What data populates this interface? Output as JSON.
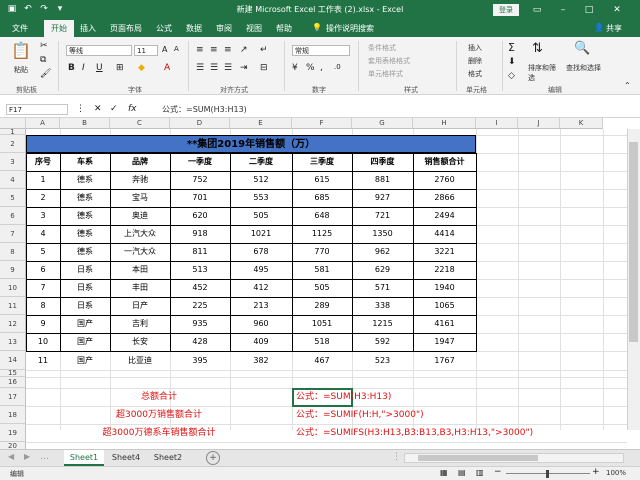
{
  "window": {
    "title": "新建 Microsoft Excel 工作表 (2).xlsx  -  Excel",
    "login": "登录"
  },
  "tabs": [
    {
      "label": "文件"
    },
    {
      "label": "开始"
    },
    {
      "label": "插入"
    },
    {
      "label": "页面布局"
    },
    {
      "label": "公式"
    },
    {
      "label": "数据"
    },
    {
      "label": "审阅"
    },
    {
      "label": "视图"
    },
    {
      "label": "帮助"
    },
    {
      "label": "操作说明搜索"
    }
  ],
  "share_label": "共享",
  "ribbon": {
    "paste": "粘贴",
    "font_name": "等线",
    "font_size": "11",
    "conditional_format": "条件格式",
    "table_format": "套用表格格式",
    "cell_style": "单元格样式",
    "number_format": "常规",
    "insert": "插入",
    "delete": "删除",
    "format": "格式",
    "sort_filter": "排序和筛选",
    "find_select": "查找和选择",
    "groups": [
      "剪贴板",
      "字体",
      "对齐方式",
      "数字",
      "样式",
      "单元格",
      "编辑"
    ]
  },
  "formula_bar": {
    "name_box": "F17",
    "content": "公式：=SUM(H3:H13)"
  },
  "columns": [
    "A",
    "B",
    "C",
    "D",
    "E",
    "F",
    "G",
    "H",
    "I",
    "J",
    "K"
  ],
  "rows": [
    "1",
    "2",
    "3",
    "4",
    "5",
    "6",
    "7",
    "8",
    "9",
    "10",
    "11",
    "12",
    "13",
    "14",
    "15",
    "16",
    "17",
    "18",
    "19",
    "20"
  ],
  "table": {
    "title": "**集团2019年销售额（万）",
    "headers": [
      "序号",
      "车系",
      "品牌",
      "一季度",
      "二季度",
      "三季度",
      "四季度",
      "销售额合计"
    ],
    "rows": [
      [
        "1",
        "德系",
        "奔驰",
        "752",
        "512",
        "615",
        "881",
        "2760"
      ],
      [
        "2",
        "德系",
        "宝马",
        "701",
        "553",
        "685",
        "927",
        "2866"
      ],
      [
        "3",
        "德系",
        "奥迪",
        "620",
        "505",
        "648",
        "721",
        "2494"
      ],
      [
        "4",
        "德系",
        "上汽大众",
        "918",
        "1021",
        "1125",
        "1350",
        "4414"
      ],
      [
        "5",
        "德系",
        "一汽大众",
        "811",
        "678",
        "770",
        "962",
        "3221"
      ],
      [
        "6",
        "日系",
        "本田",
        "513",
        "495",
        "581",
        "629",
        "2218"
      ],
      [
        "7",
        "日系",
        "丰田",
        "452",
        "412",
        "505",
        "571",
        "1940"
      ],
      [
        "8",
        "日系",
        "日产",
        "225",
        "213",
        "289",
        "338",
        "1065"
      ],
      [
        "9",
        "国产",
        "吉利",
        "935",
        "960",
        "1051",
        "1215",
        "4161"
      ],
      [
        "10",
        "国产",
        "长安",
        "428",
        "409",
        "518",
        "592",
        "1947"
      ],
      [
        "11",
        "国产",
        "比亚迪",
        "395",
        "382",
        "467",
        "523",
        "1767"
      ]
    ]
  },
  "notes": {
    "labels": [
      "总额合计",
      "超3000万销售额合计",
      "超3000万德系车销售额合计"
    ],
    "formulas": [
      "公式：=SUM(H3:H13)",
      "公式：=SUMIF(H:H,\">3000\")",
      "公式：=SUMIFS(H3:H13,B3:B13,B3,H3:H13,\">3000\")"
    ]
  },
  "sheets": [
    {
      "label": "Sheet1"
    },
    {
      "label": "Sheet4"
    },
    {
      "label": "Sheet2"
    }
  ],
  "status": {
    "mode": "编辑",
    "zoom": "100%"
  },
  "colors": {
    "accent": "#217346",
    "title_fill": "#4472c4",
    "note_red": "#e01010"
  }
}
